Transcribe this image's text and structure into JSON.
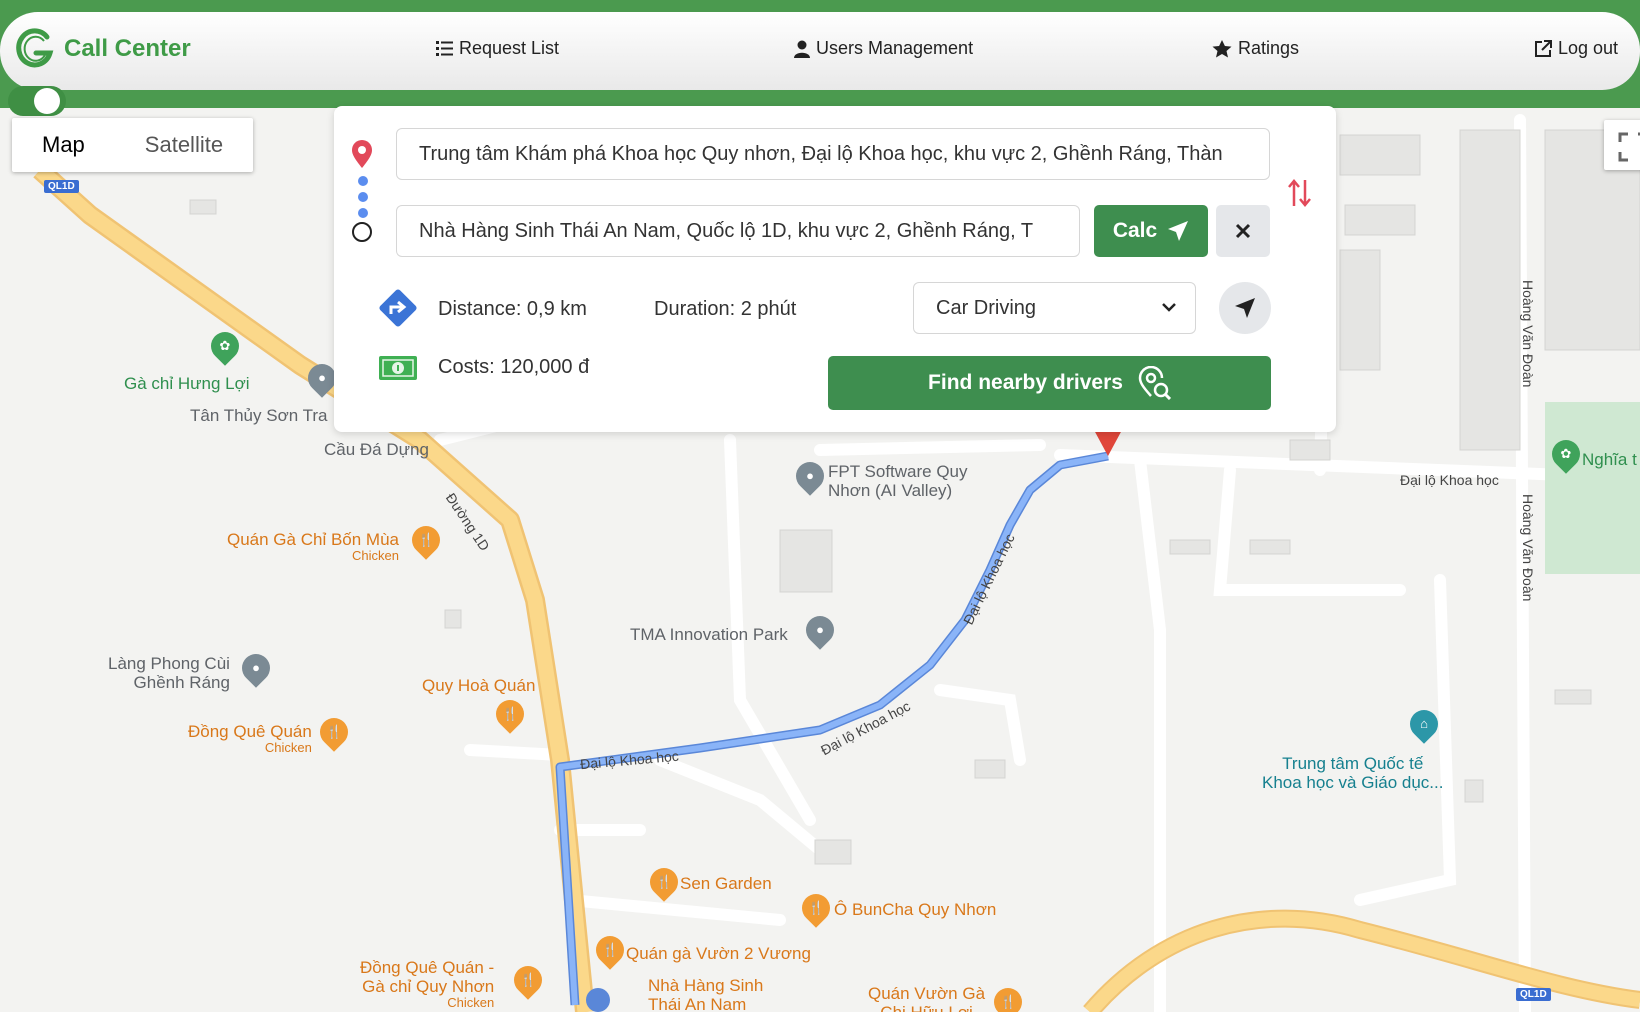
{
  "header": {
    "brand": "Call Center",
    "nav": {
      "request_list": "Request List",
      "users_management": "Users Management",
      "ratings": "Ratings",
      "logout": "Log out"
    }
  },
  "map_type": {
    "map": "Map",
    "satellite": "Satellite"
  },
  "route_panel": {
    "origin_value": "Trung tâm Khám phá Khoa học Quy nhơn, Đại lộ Khoa học, khu vực 2, Ghềnh Ráng, Thàn",
    "destination_value": "Nhà Hàng Sinh Thái An Nam, Quốc lộ 1D, khu vực 2, Ghềnh Ráng, T",
    "calc_label": "Calc",
    "distance": "Distance: 0,9 km",
    "duration": "Duration: 2 phút",
    "travel_mode": "Car Driving",
    "costs": "Costs: 120,000 đ",
    "find_drivers_label": "Find nearby drivers"
  },
  "map_labels": {
    "ga_chi_hung_loi": "Gà chỉ Hưng Lợi",
    "tan_thuy_son_tra": "Tân Thủy Sơn Tra",
    "cau_da_dung": "Cầu Đá Dựng",
    "duong_1d": "Đường 1D",
    "quan_ga_chi_bon_mua": "Quán Gà Chỉ Bốn Mùa",
    "chicken": "Chicken",
    "fpt_line1": "FPT Software Quy",
    "fpt_line2": "Nhơn (AI Valley)",
    "tma": "TMA Innovation Park",
    "lang_phong_line1": "Làng Phong Cùi",
    "lang_phong_line2": "Ghềnh Ráng",
    "quy_hoa_quan": "Quy Hoà Quán",
    "dong_que_quan": "Đồng Quê Quán",
    "dai_lo_khoa_hoc": "Đại lộ Khoa học",
    "hoang_van_doan": "Hoàng Văn Đoàn",
    "nghia": "Nghĩa t",
    "trung_tam_line1": "Trung tâm Quốc tế",
    "trung_tam_line2": "Khoa học và Giáo dục...",
    "sen_garden": "Sen Garden",
    "o_buncha": "Ô BunCha Quy Nhơn",
    "quan_ga_vuon": "Quán gà Vườn 2 Vương",
    "dong_que_quan_2_line1": "Đồng Quê Quán -",
    "dong_que_quan_2_line2": "Gà chỉ Quy Nhơn",
    "nha_hang_line1": "Nhà Hàng Sinh",
    "nha_hang_line2": "Thái An Nam",
    "quan_vuon_ga_line1": "Quán Vườn Gà",
    "quan_vuon_ga_line2": "Chị Hữu Lợi",
    "ql1d": "QL1D"
  },
  "colors": {
    "brand_green": "#3e8e4f",
    "route_blue": "#7aa8ea",
    "road_yellow": "#fbd88a"
  }
}
